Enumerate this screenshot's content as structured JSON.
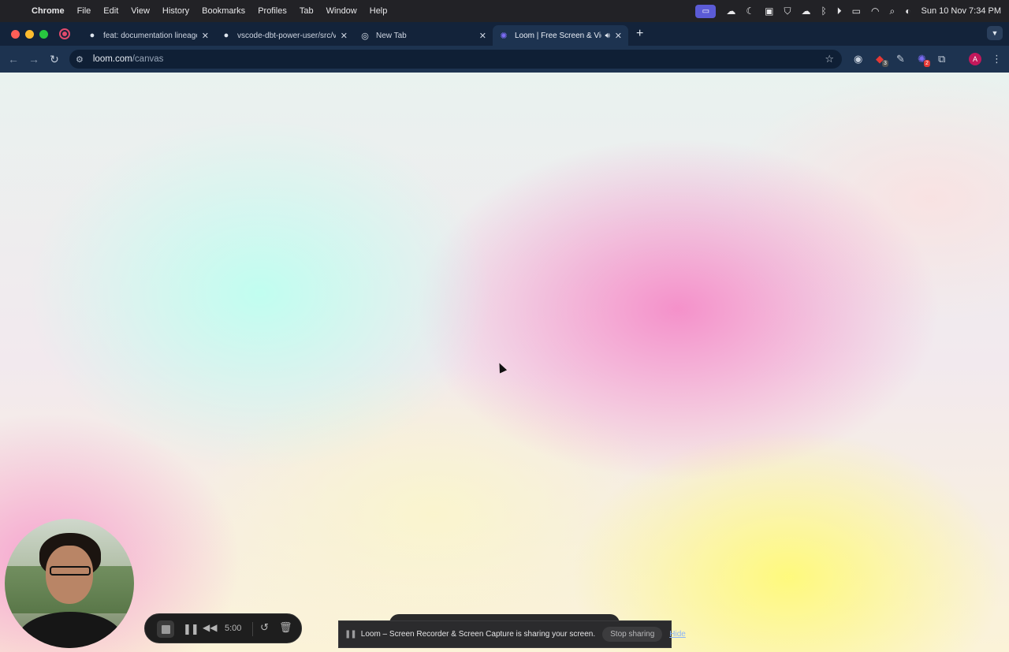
{
  "menubar": {
    "app": "Chrome",
    "items": [
      "File",
      "Edit",
      "View",
      "History",
      "Bookmarks",
      "Profiles",
      "Tab",
      "Window",
      "Help"
    ],
    "clock": "Sun 10 Nov  7:34 PM"
  },
  "tabs": [
    {
      "title": "feat: documentation lineage p",
      "icon": "github-icon"
    },
    {
      "title": "vscode-dbt-power-user/src/v",
      "icon": "github-icon"
    },
    {
      "title": "New Tab",
      "icon": "chrome-icon"
    },
    {
      "title": "Loom | Free Screen & Vide",
      "icon": "loom-icon",
      "active": true,
      "audio": true
    }
  ],
  "address": {
    "host": "loom.com",
    "path": "/canvas"
  },
  "extensions": {
    "badge_red": "3",
    "badge_loom": "2",
    "avatar": "A"
  },
  "recorder": {
    "time": "5:00"
  },
  "sharing": {
    "message": "Loom – Screen Recorder & Screen Capture is sharing your screen.",
    "stop_label": "Stop sharing",
    "hide_label": "Hide"
  },
  "colors": {
    "accent": "#5b5bd6",
    "tab_strip": "#13233a",
    "toolbar": "#1d3350"
  }
}
